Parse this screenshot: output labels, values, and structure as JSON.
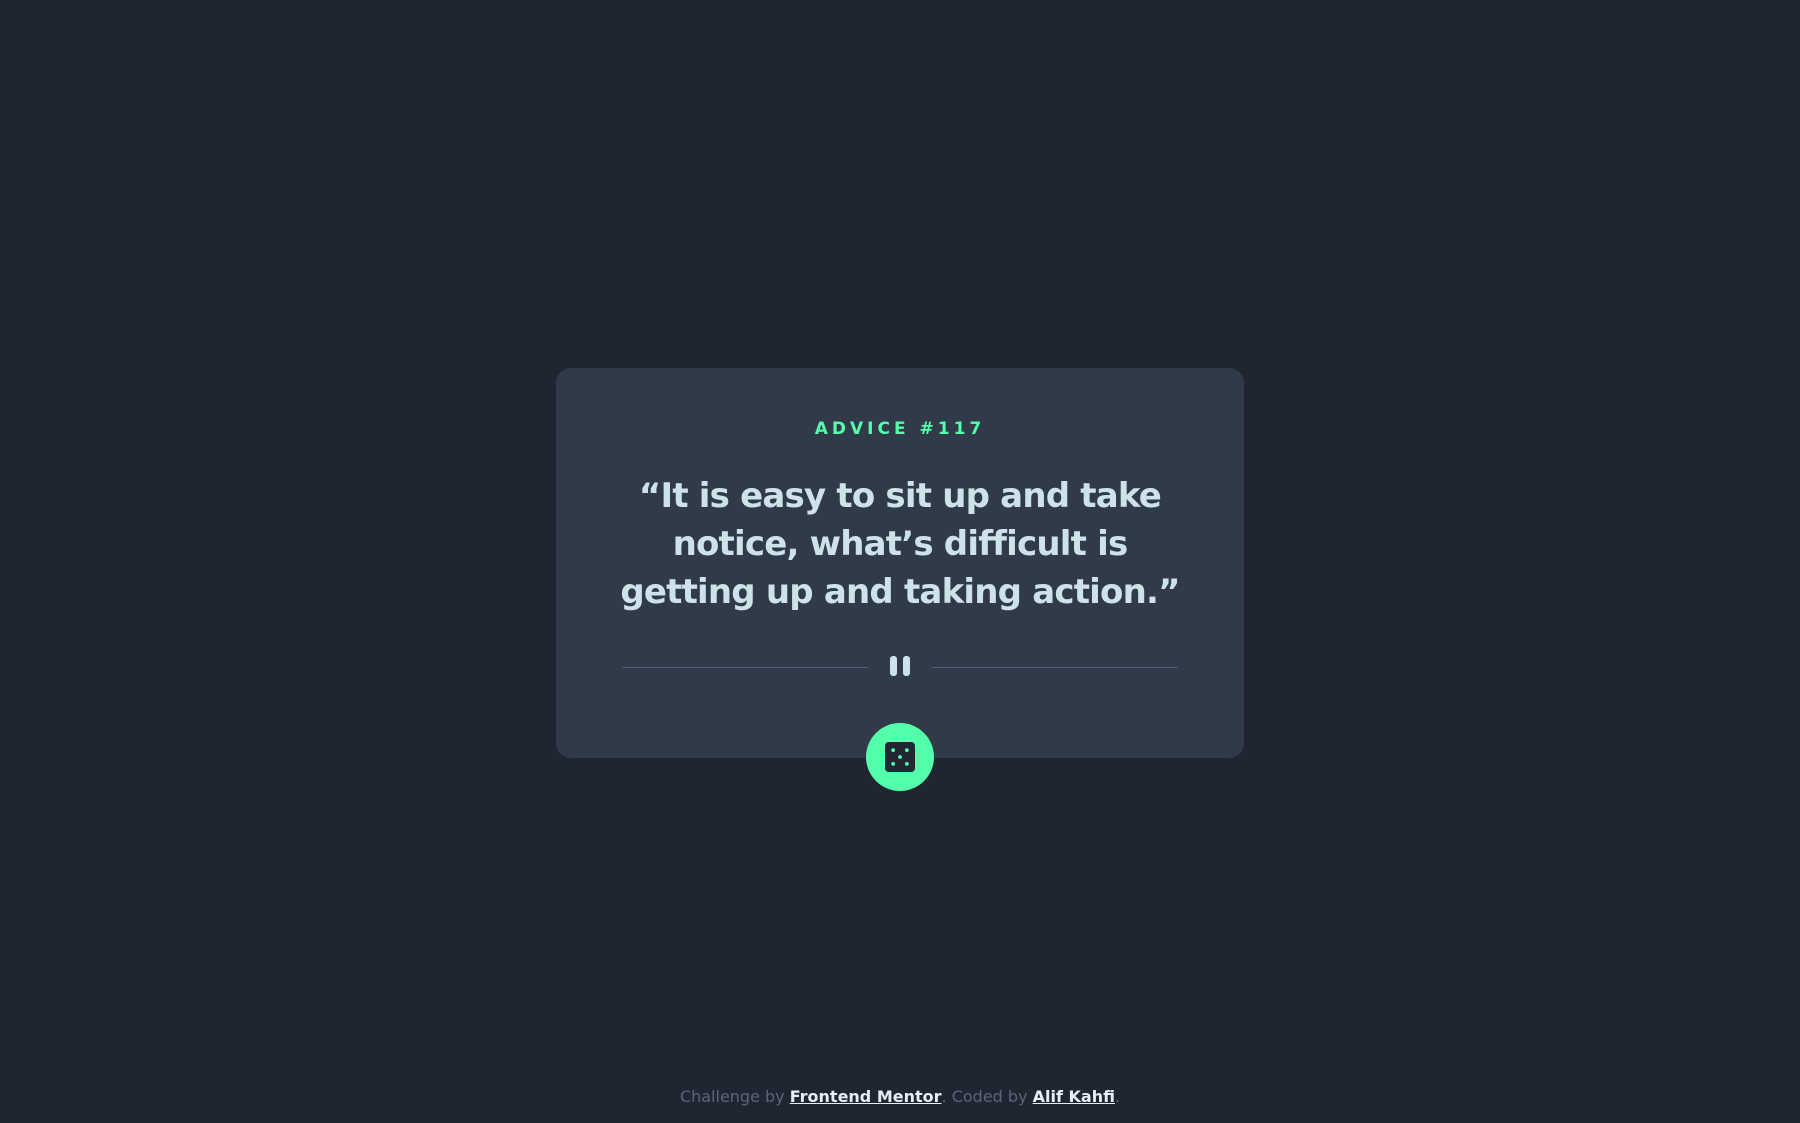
{
  "card": {
    "advice_label": "ADVICE #117",
    "quote": "“It is easy to sit up and take notice, what’s difficult is getting up and taking action.”"
  },
  "icons": {
    "divider": "pause-icon",
    "button": "dice-icon"
  },
  "footer": {
    "prefix": "Challenge by ",
    "link1": "Frontend Mentor",
    "middle": ". Coded by ",
    "link2": "Alif Kahfi",
    "suffix": "."
  },
  "colors": {
    "background": "#1f2632",
    "card": "#313a49",
    "accent": "#53ffaa",
    "text": "#cee3e9",
    "muted": "#5a6578"
  }
}
